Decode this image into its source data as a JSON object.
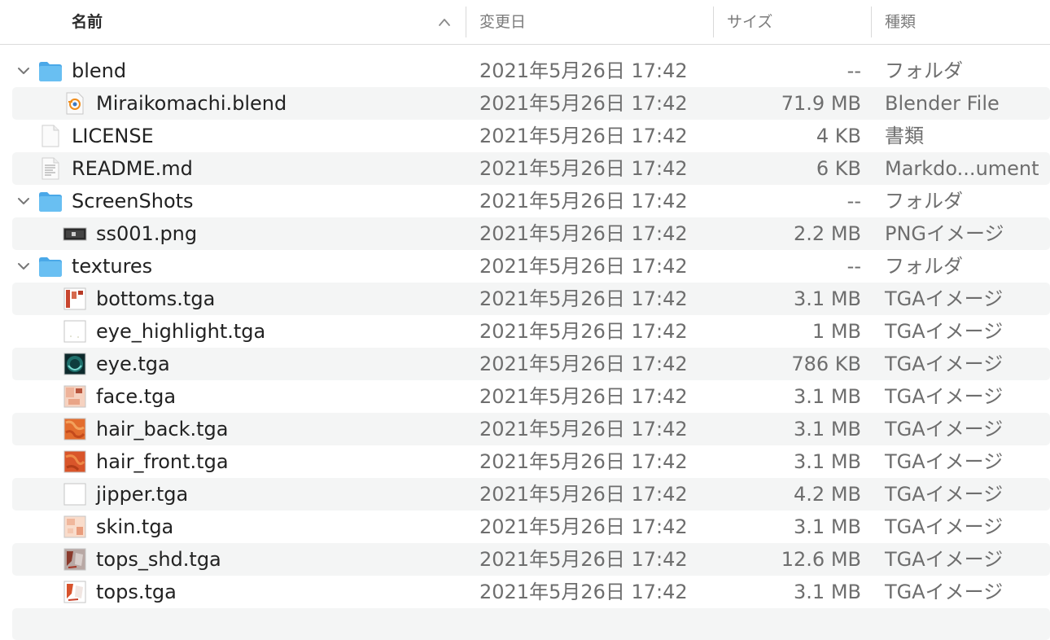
{
  "header": {
    "name": "名前",
    "date": "変更日",
    "size": "サイズ",
    "kind": "種類"
  },
  "rows": [
    {
      "name": "blend",
      "date": "2021年5月26日 17:42",
      "size": "--",
      "kind": "フォルダ",
      "icon": "folder-icon",
      "expanded": true
    },
    {
      "name": "Miraikomachi.blend",
      "date": "2021年5月26日 17:42",
      "size": "71.9 MB",
      "kind": "Blender File",
      "icon": "blender-file-icon"
    },
    {
      "name": "LICENSE",
      "date": "2021年5月26日 17:42",
      "size": "4 KB",
      "kind": "書類",
      "icon": "document-icon"
    },
    {
      "name": "README.md",
      "date": "2021年5月26日 17:42",
      "size": "6 KB",
      "kind": "Markdo...ument",
      "icon": "markdown-file-icon"
    },
    {
      "name": "ScreenShots",
      "date": "2021年5月26日 17:42",
      "size": "--",
      "kind": "フォルダ",
      "icon": "folder-icon",
      "expanded": true
    },
    {
      "name": "ss001.png",
      "date": "2021年5月26日 17:42",
      "size": "2.2 MB",
      "kind": "PNGイメージ",
      "icon": "png-thumbnail-icon"
    },
    {
      "name": "textures",
      "date": "2021年5月26日 17:42",
      "size": "--",
      "kind": "フォルダ",
      "icon": "folder-icon",
      "expanded": true
    },
    {
      "name": "bottoms.tga",
      "date": "2021年5月26日 17:42",
      "size": "3.1 MB",
      "kind": "TGAイメージ",
      "icon": "tga-thumbnail-icon"
    },
    {
      "name": "eye_highlight.tga",
      "date": "2021年5月26日 17:42",
      "size": "1 MB",
      "kind": "TGAイメージ",
      "icon": "tga-thumbnail-icon"
    },
    {
      "name": "eye.tga",
      "date": "2021年5月26日 17:42",
      "size": "786 KB",
      "kind": "TGAイメージ",
      "icon": "tga-thumbnail-icon"
    },
    {
      "name": "face.tga",
      "date": "2021年5月26日 17:42",
      "size": "3.1 MB",
      "kind": "TGAイメージ",
      "icon": "tga-thumbnail-icon"
    },
    {
      "name": "hair_back.tga",
      "date": "2021年5月26日 17:42",
      "size": "3.1 MB",
      "kind": "TGAイメージ",
      "icon": "tga-thumbnail-icon"
    },
    {
      "name": "hair_front.tga",
      "date": "2021年5月26日 17:42",
      "size": "3.1 MB",
      "kind": "TGAイメージ",
      "icon": "tga-thumbnail-icon"
    },
    {
      "name": "jipper.tga",
      "date": "2021年5月26日 17:42",
      "size": "4.2 MB",
      "kind": "TGAイメージ",
      "icon": "tga-thumbnail-icon"
    },
    {
      "name": "skin.tga",
      "date": "2021年5月26日 17:42",
      "size": "3.1 MB",
      "kind": "TGAイメージ",
      "icon": "tga-thumbnail-icon"
    },
    {
      "name": "tops_shd.tga",
      "date": "2021年5月26日 17:42",
      "size": "12.6 MB",
      "kind": "TGAイメージ",
      "icon": "tga-thumbnail-icon"
    },
    {
      "name": "tops.tga",
      "date": "2021年5月26日 17:42",
      "size": "3.1 MB",
      "kind": "TGAイメージ",
      "icon": "tga-thumbnail-icon"
    }
  ],
  "colors": {
    "folder": "#5fb6ee",
    "stripe": "#f4f5f5",
    "text": "#222222",
    "secondary_text": "#6e6e6e"
  }
}
